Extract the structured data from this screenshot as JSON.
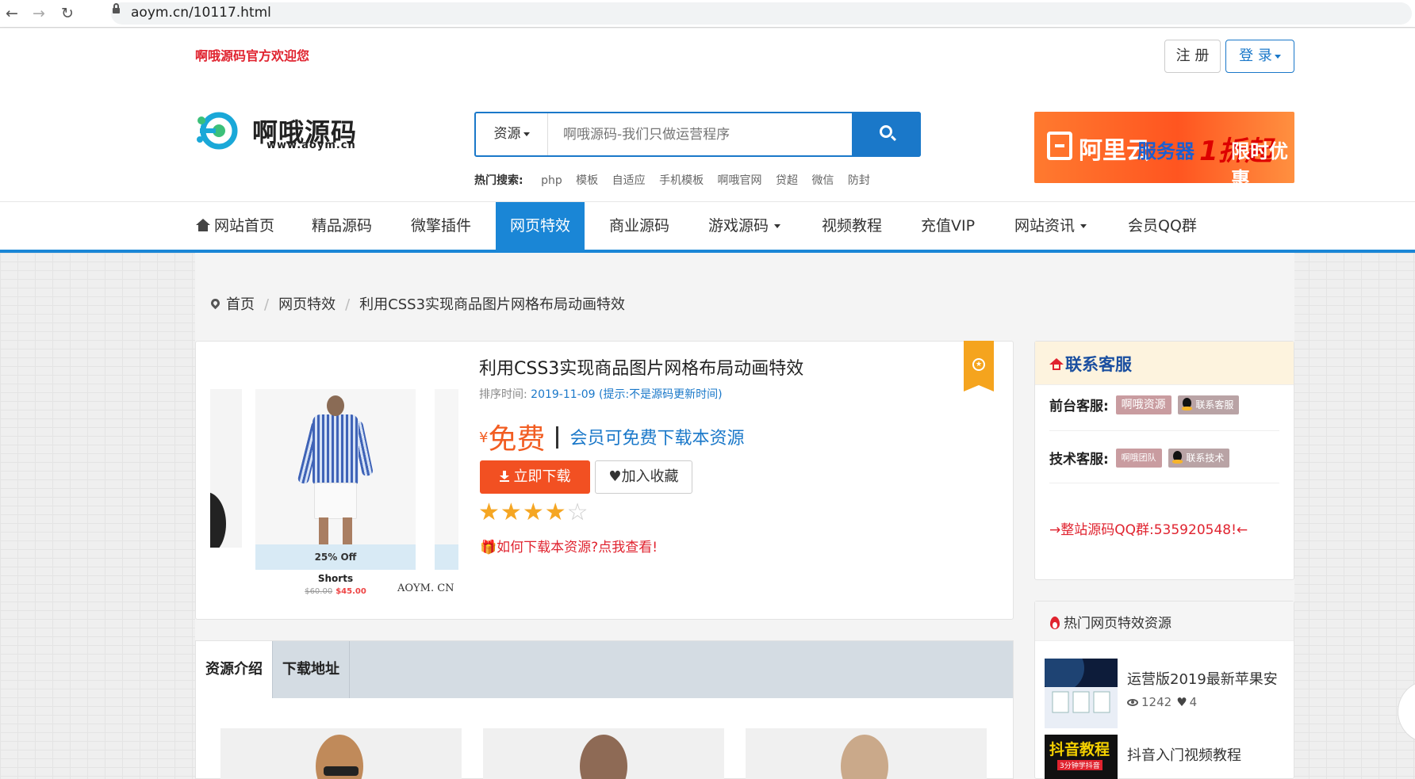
{
  "browser": {
    "url": "aoym.cn/10117.html"
  },
  "topbar": {
    "welcome": "啊哦源码官方欢迎您",
    "register": "注 册",
    "login": "登 录"
  },
  "logo": {
    "name": "啊哦源码",
    "sub": "www.aoym.cn"
  },
  "search": {
    "category": "资源",
    "placeholder": "啊哦源码-我们只做运营程序"
  },
  "hot_search": {
    "label": "热门搜索:",
    "items": [
      "php",
      "模板",
      "自适应",
      "手机模板",
      "啊哦官网",
      "贷超",
      "微信",
      "防封"
    ]
  },
  "ad": {
    "brand": "阿里云",
    "server": "服务器",
    "deal": "1折起",
    "time": "限时优惠"
  },
  "nav": {
    "items": [
      "网站首页",
      "精品源码",
      "微擎插件",
      "网页特效",
      "商业源码",
      "游戏源码",
      "视频教程",
      "充值VIP",
      "网站资讯",
      "会员QQ群"
    ]
  },
  "breadcrumb": {
    "home": "首页",
    "category": "网页特效",
    "current": "利用CSS3实现商品图片网格布局动画特效"
  },
  "product": {
    "title": "利用CSS3实现商品图片网格布局动画特效",
    "time_label": "排序时间:",
    "date": "2019-11-09",
    "note": "(提示:不是源码更新时间)",
    "yen": "¥",
    "price": "免费",
    "vip_text": "会员可免费下载本资源",
    "download": "立即下载",
    "favorite": "加入收藏",
    "rating": 4,
    "rating_max": 5,
    "howto": "如何下载本资源?点我查看!",
    "gallery": {
      "badge": "25% Off",
      "caption": "Shorts",
      "old_price": "$60.00",
      "new_price": "$45.00",
      "brand": "AOYM. CN"
    }
  },
  "tabs": {
    "items": [
      "资源介绍",
      "下载地址"
    ]
  },
  "service": {
    "title": "联系客服",
    "front_label": "前台客服:",
    "front_tag": "啊哦资源",
    "front_qq": "联系客服",
    "tech_label": "技术客服:",
    "tech_tag": "啊哦团队",
    "tech_qq": "联系技术",
    "qq_group": "→整站源码QQ群:535920548!←"
  },
  "hot_resources": {
    "title": "热门网页特效资源",
    "items": [
      {
        "name": "运营版2019最新苹果安",
        "views": "1242",
        "likes": "4"
      },
      {
        "name": "抖音入门视频教程",
        "views": "",
        "likes": ""
      }
    ],
    "thumb2_text": "抖音教程",
    "thumb2_sub": "3分钟学抖音"
  },
  "colors": {
    "accent": "#1a86d6",
    "brand_red": "#e0232f",
    "orange": "#f25d22",
    "gold": "#f5a623"
  }
}
